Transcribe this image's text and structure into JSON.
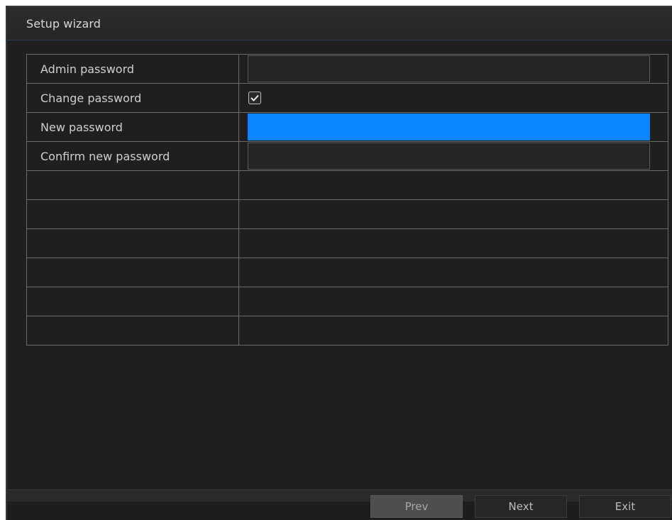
{
  "window": {
    "title": "Setup wizard"
  },
  "form": {
    "rows": [
      {
        "label": "Admin password",
        "value": ""
      },
      {
        "label": "Change password",
        "checked": true
      },
      {
        "label": "New password",
        "value": ""
      },
      {
        "label": "Confirm new password",
        "value": ""
      }
    ]
  },
  "buttons": {
    "prev": "Prev",
    "next": "Next",
    "exit": "Exit"
  },
  "colors": {
    "accent": "#0a84ff",
    "background": "#1f1f1f",
    "grid_line": "#6a6a6a"
  }
}
